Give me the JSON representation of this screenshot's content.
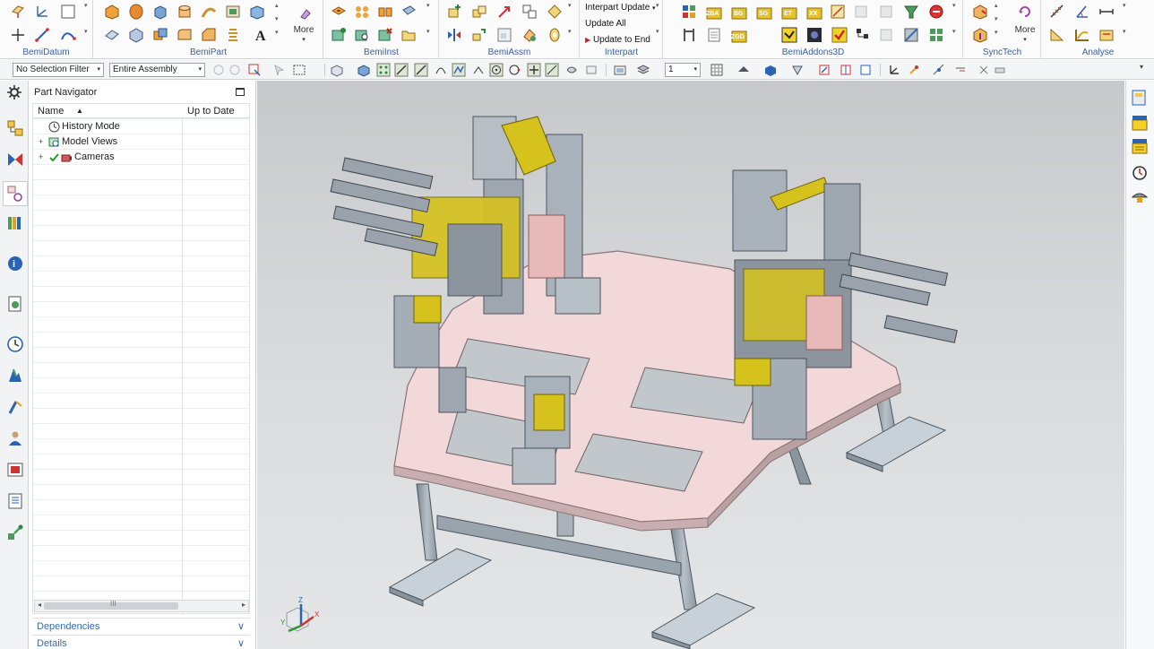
{
  "ribbon": {
    "groups": [
      {
        "label": "BemiDatum"
      },
      {
        "label": "BemiPart",
        "more": "More"
      },
      {
        "label": "BemiInst"
      },
      {
        "label": "BemiAssm"
      },
      {
        "label": "Interpart",
        "commands": [
          "Interpart Update",
          "Update All",
          "Update to End"
        ]
      },
      {
        "label": "BemiAddons3D",
        "button_texts": [
          "ZBA",
          "BG",
          "SG",
          "ET",
          "XX",
          "ZGD"
        ]
      },
      {
        "label": "SyncTech",
        "more": "More"
      },
      {
        "label": "Analyse"
      }
    ]
  },
  "toolbar": {
    "selection_filter": "No Selection Filter",
    "scope": "Entire Assembly",
    "layer_value": "1"
  },
  "part_navigator": {
    "title": "Part Navigator",
    "columns": [
      "Name",
      "Up to Date"
    ],
    "sort_indicator": "▲",
    "rows": [
      {
        "label": "History Mode",
        "icon": "clock-icon",
        "expander": ""
      },
      {
        "label": "Model Views",
        "icon": "model-views-icon",
        "expander": "+"
      },
      {
        "label": "Cameras",
        "icon": "camera-icon",
        "expander": "+",
        "checked": true
      }
    ],
    "scroll_grip": "III",
    "sections": [
      "Dependencies",
      "Details"
    ]
  },
  "graphics": {
    "triad_labels": {
      "x": "X",
      "y": "Y",
      "z": "Z"
    }
  },
  "colors": {
    "plate": "#f2d8d8",
    "plate_edge": "#8a7478",
    "steel": "#a9b2ba",
    "yellow": "#d6c21c",
    "accent_blue": "#3a5f96",
    "viewport_top": "#c6c8cb"
  }
}
